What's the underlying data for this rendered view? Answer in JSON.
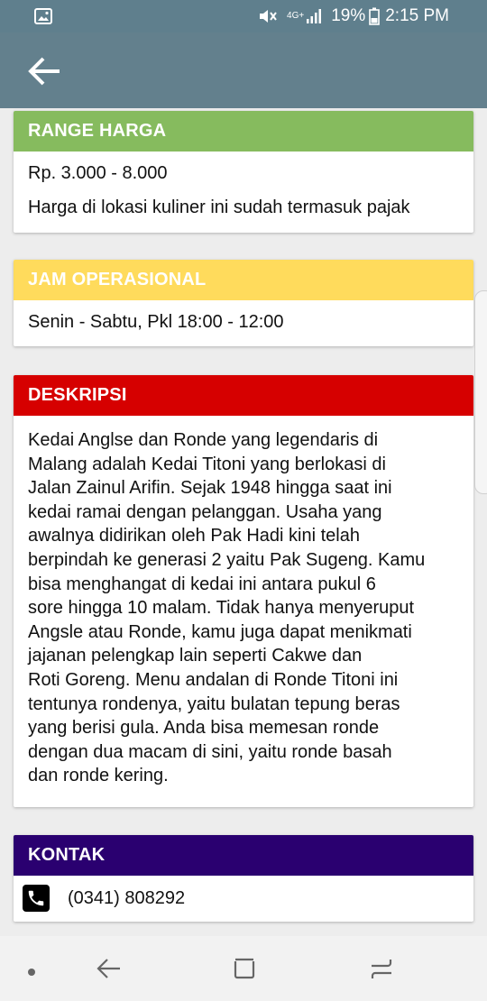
{
  "status_bar": {
    "left_icon": "image-icon",
    "network": "4G+",
    "battery": "19%",
    "time": "2:15 PM"
  },
  "app_bar": {
    "back_icon": "arrow-left-icon"
  },
  "cards": {
    "harga": {
      "title": "RANGE HARGA",
      "color": "#86bb5e",
      "lines": [
        "Rp. 3.000 - 8.000",
        "Harga di lokasi kuliner ini sudah termasuk pajak"
      ]
    },
    "jam": {
      "title": "JAM OPERASIONAL",
      "color": "#ffdb5c",
      "lines": [
        "Senin - Sabtu, Pkl 18:00 - 12:00"
      ]
    },
    "deskripsi": {
      "title": "DESKRIPSI",
      "color": "#d60000",
      "lines": [
        "Kedai Anglse dan Ronde yang legendaris di",
        "Malang adalah Kedai Titoni yang berlokasi di",
        "Jalan Zainul Arifin. Sejak 1948 hingga saat ini",
        "kedai ramai dengan pelanggan. Usaha yang",
        "awalnya didirikan oleh Pak Hadi kini telah",
        "berpindah ke generasi 2 yaitu Pak Sugeng. Kamu",
        "bisa menghangat di kedai ini antara pukul 6",
        "sore hingga 10 malam. Tidak hanya menyeruput",
        "Angsle atau Ronde, kamu juga dapat menikmati",
        "jajanan pelengkap lain seperti Cakwe dan",
        "Roti Goreng. Menu andalan di Ronde Titoni ini",
        "tentunya rondenya, yaitu bulatan tepung beras",
        "yang berisi gula. Anda bisa memesan ronde",
        "dengan dua macam di sini, yaitu ronde basah",
        "dan ronde kering."
      ]
    },
    "kontak": {
      "title": "KONTAK",
      "color": "#2a0070",
      "phone_icon": "phone-icon",
      "phone": "(0341) 808292"
    }
  },
  "nav_bar": {
    "icons": [
      "dot-icon",
      "back-icon",
      "recent-apps-icon",
      "switch-icon"
    ]
  }
}
